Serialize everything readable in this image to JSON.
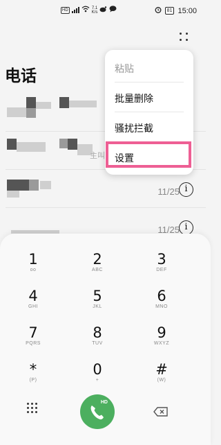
{
  "status_bar": {
    "hd": "HD",
    "network": "4G",
    "speed_value": "7.1",
    "speed_unit": "K/s",
    "battery": "81",
    "time": "15:00"
  },
  "page_title": "电话",
  "menu": {
    "items": [
      "粘贴",
      "批量删除",
      "骚扰拦截",
      "设置"
    ],
    "highlighted_item": "设置"
  },
  "call_list": [
    {
      "date": "",
      "note": ""
    },
    {
      "date": "",
      "note": "主叫"
    },
    {
      "date": "11/25",
      "note": ""
    },
    {
      "date": "11/25",
      "note": ""
    }
  ],
  "info_glyph": "i",
  "dialpad": {
    "keys": [
      {
        "digit": "1",
        "sub": "oo"
      },
      {
        "digit": "2",
        "sub": "ABC"
      },
      {
        "digit": "3",
        "sub": "DEF"
      },
      {
        "digit": "4",
        "sub": "GHI"
      },
      {
        "digit": "5",
        "sub": "JKL"
      },
      {
        "digit": "6",
        "sub": "MNO"
      },
      {
        "digit": "7",
        "sub": "PQRS"
      },
      {
        "digit": "8",
        "sub": "TUV"
      },
      {
        "digit": "9",
        "sub": "WXYZ"
      },
      {
        "digit": "*",
        "sub": "(P)"
      },
      {
        "digit": "0",
        "sub": "+"
      },
      {
        "digit": "#",
        "sub": "(W)"
      }
    ],
    "call_badge": "HD"
  },
  "colors": {
    "highlight": "#ee5f94",
    "call_button": "#4caf5f"
  }
}
